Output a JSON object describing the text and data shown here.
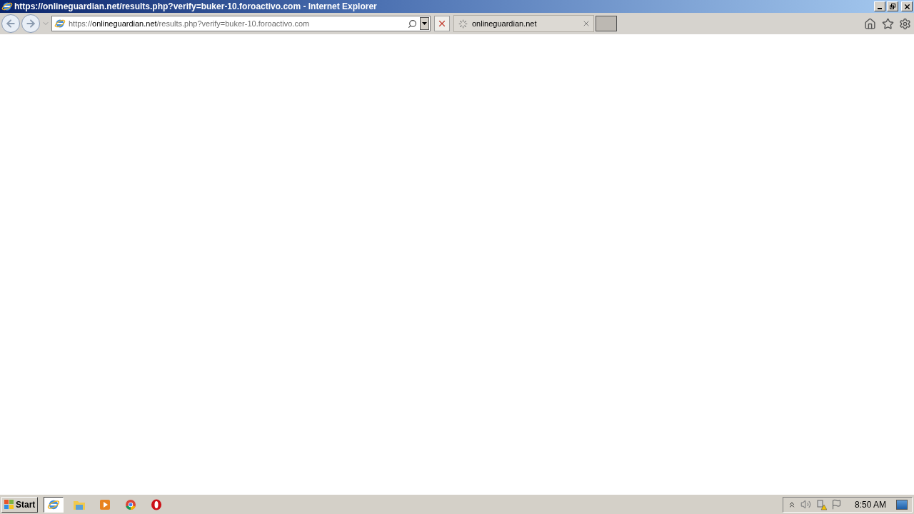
{
  "window": {
    "title": "https://onlineguardian.net/results.php?verify=buker-10.foroactivo.com - Internet Explorer"
  },
  "address_bar": {
    "scheme": "https://",
    "domain": "onlineguardian.net",
    "path": "/results.php?verify=buker-10.foroactivo.com"
  },
  "tabs": [
    {
      "title": "onlineguardian.net",
      "selected": true,
      "loading": true
    }
  ],
  "taskbar": {
    "start": "Start",
    "items": [
      {
        "kind": "ie",
        "selected": true
      },
      {
        "kind": "folder",
        "selected": false
      },
      {
        "kind": "media",
        "selected": false
      },
      {
        "kind": "chrome",
        "selected": false
      },
      {
        "kind": "opera",
        "selected": false
      }
    ],
    "clock": "8:50 AM"
  }
}
